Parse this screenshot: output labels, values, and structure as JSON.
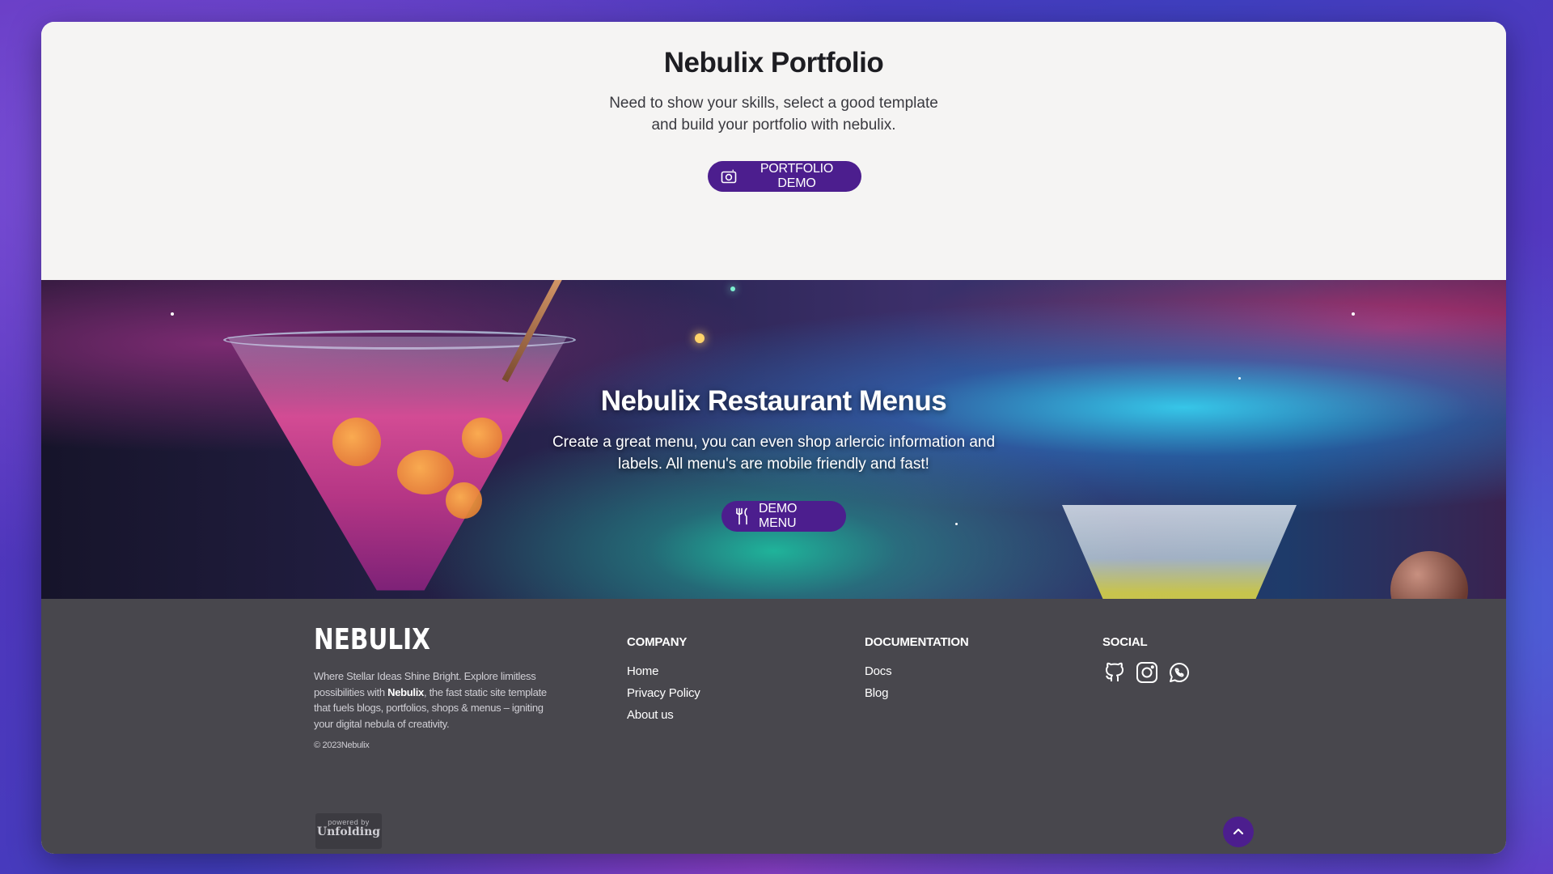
{
  "portfolio": {
    "title": "Nebulix Portfolio",
    "description": "Need to show your skills, select a good template and build your portfolio with nebulix.",
    "button_label": "PORTFOLIO DEMO",
    "button_icon": "camera-icon"
  },
  "restaurant": {
    "title": "Nebulix Restaurant Menus",
    "description": "Create a great menu, you can even shop arlercic information and labels. All menu's are mobile friendly and fast!",
    "button_label": "DEMO MENU",
    "button_icon": "utensils-icon"
  },
  "footer": {
    "brand": "NEBULIX",
    "tagline_pre": "Where Stellar Ideas Shine Bright. Explore limitless possibilities with ",
    "tagline_bold": "Nebulix",
    "tagline_post": ", the fast static site template that fuels blogs, portfolios, shops & menus – igniting your digital nebula of creativity.",
    "copyright": "© 2023Nebulix",
    "company": {
      "heading": "COMPANY",
      "links": [
        "Home",
        "Privacy Policy",
        "About us"
      ]
    },
    "documentation": {
      "heading": "DOCUMENTATION",
      "links": [
        "Docs",
        "Blog"
      ]
    },
    "social": {
      "heading": "SOCIAL",
      "icons": [
        "github-icon",
        "instagram-icon",
        "whatsapp-icon"
      ]
    },
    "powered_by": {
      "small": "powered by",
      "name": "Unfolding"
    },
    "back_to_top_icon": "chevron-up-icon"
  },
  "colors": {
    "accent": "#4c1e8e",
    "footer_bg": "#48474d",
    "page_bg": "#f5f4f3"
  }
}
